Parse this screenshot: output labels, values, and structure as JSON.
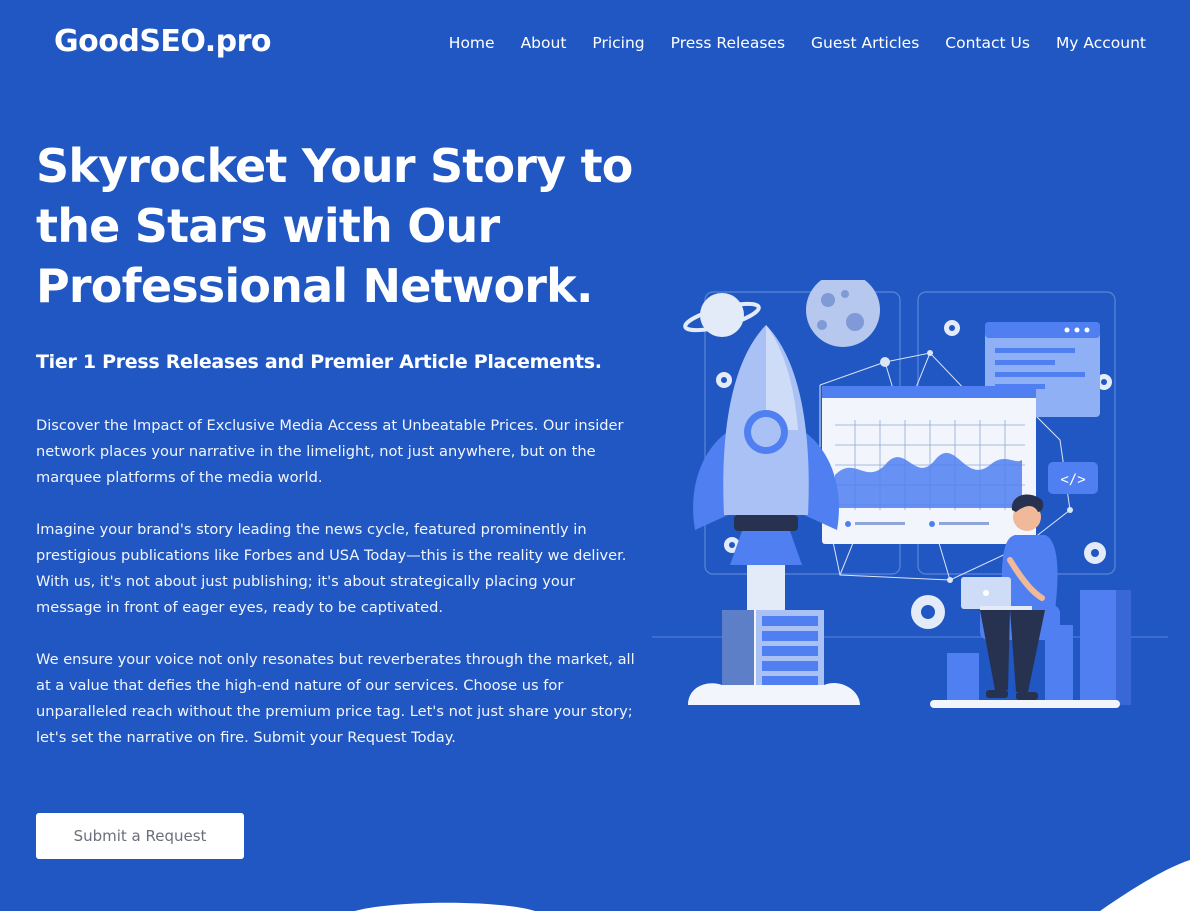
{
  "header": {
    "logo": "GoodSEO.pro",
    "nav": [
      {
        "label": "Home"
      },
      {
        "label": "About"
      },
      {
        "label": "Pricing"
      },
      {
        "label": "Press Releases"
      },
      {
        "label": "Guest Articles"
      },
      {
        "label": "Contact Us"
      },
      {
        "label": "My Account"
      }
    ]
  },
  "hero": {
    "title": "Skyrocket Your Story to the Stars with Our Professional Network.",
    "subtitle": "Tier 1 Press Releases and Premier Article Placements.",
    "paragraphs": [
      "Discover the Impact of Exclusive Media Access at Unbeatable Prices. Our insider network places your narrative in the limelight, not just anywhere, but on the marquee platforms of the media world.",
      "Imagine your brand's story leading the news cycle, featured prominently in prestigious publications like Forbes and USA Today—this is the reality we deliver. With us, it's not about just publishing; it's about strategically placing your message in front of eager eyes, ready to be captivated.",
      "We ensure your voice not only resonates but reverberates through the market, all at a value that defies the high-end nature of our services. Choose us for unparalleled reach without the premium price tag. Let's not just share your story; let's set the narrative on fire. Submit your Request Today."
    ],
    "cta_label": "Submit a Request"
  },
  "illustration": {
    "code_badge": "</>"
  },
  "colors": {
    "background": "#2057c2",
    "accent_light": "#a9c1f5",
    "accent_mid": "#4f7ff0",
    "white": "#ffffff"
  }
}
